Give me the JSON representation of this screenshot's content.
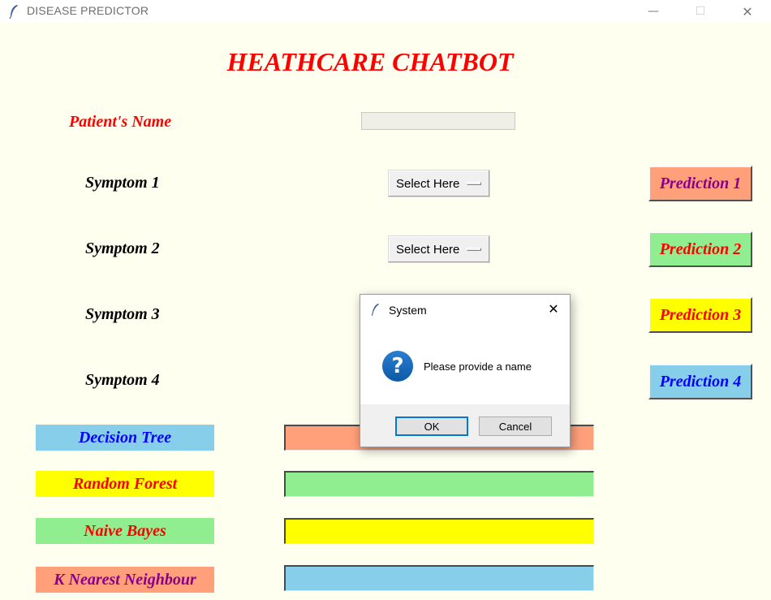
{
  "window": {
    "title": "DISEASE PREDICTOR",
    "minimize_glyph": "—",
    "maximize_glyph": "☐",
    "close_glyph": "✕"
  },
  "heading": "HEATHCARE CHATBOT",
  "patient": {
    "label": "Patient's Name",
    "value": ""
  },
  "symptoms": [
    {
      "label": "Symptom 1",
      "selected": "Select Here"
    },
    {
      "label": "Symptom 2",
      "selected": "Select Here"
    },
    {
      "label": "Symptom 3"
    },
    {
      "label": "Symptom 4"
    }
  ],
  "predictions": [
    {
      "label": "Prediction 1",
      "bg": "#ffa07a",
      "fg": "#8b008b"
    },
    {
      "label": "Prediction 2",
      "bg": "#90ee90",
      "fg": "#ff0000"
    },
    {
      "label": "Prediction 3",
      "bg": "#ffff00",
      "fg": "#ff0000"
    },
    {
      "label": "Prediction 4",
      "bg": "#87ceeb",
      "fg": "#0000ff"
    }
  ],
  "algorithms": [
    {
      "label": "Decision Tree",
      "bg": "#87ceeb",
      "fg": "#0000ff",
      "result": "",
      "result_bg": "#ffa07a"
    },
    {
      "label": "Random Forest",
      "bg": "#ffff00",
      "fg": "#ff0000",
      "result": "",
      "result_bg": "#90ee90"
    },
    {
      "label": "Naive Bayes",
      "bg": "#90ee90",
      "fg": "#ff0000",
      "result": "",
      "result_bg": "#ffff00"
    },
    {
      "label": "K Nearest Neighbour",
      "bg": "#ffa07a",
      "fg": "#8b008b",
      "result": "",
      "result_bg": "#87ceeb"
    }
  ],
  "dialog": {
    "title": "System",
    "icon": "question-icon",
    "message": "Please provide a name",
    "ok_label": "OK",
    "cancel_label": "Cancel"
  },
  "colors": {
    "background": "#fffff0",
    "heading": "#ff0000",
    "patient_label": "#ff0000",
    "symptom_label": "#000000"
  }
}
